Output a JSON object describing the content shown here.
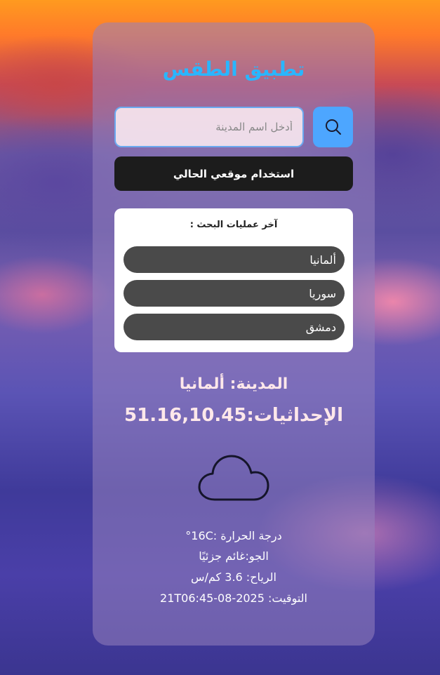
{
  "app": {
    "title": "تطبيق الطقس"
  },
  "search": {
    "placeholder": "أدخل اسم المدينة",
    "value": "",
    "button_icon": "search-icon"
  },
  "location_button": {
    "label": "استخدام موقعي الحالي"
  },
  "recent": {
    "title": "آخر عمليات البحث :",
    "items": [
      "ألمانيا",
      "سوريا",
      "دمشق"
    ]
  },
  "result": {
    "city_line": "المدينة: ألمانيا",
    "coords_line": "الإحداثيات:51.16,10.45",
    "icon": "cloud-icon",
    "temperature_line": "درجة الحرارة :16C°",
    "condition_line": "الجو:غائم جزئيًا",
    "wind_line": "الرياح: 3.6 كم/س",
    "time_line": "التوقيت: 2025-08-21T06:45"
  },
  "colors": {
    "title": "#29b6ff",
    "search_button": "#4da6ff",
    "location_button": "#1c1c1c",
    "recent_item": "#4a4a4a"
  }
}
